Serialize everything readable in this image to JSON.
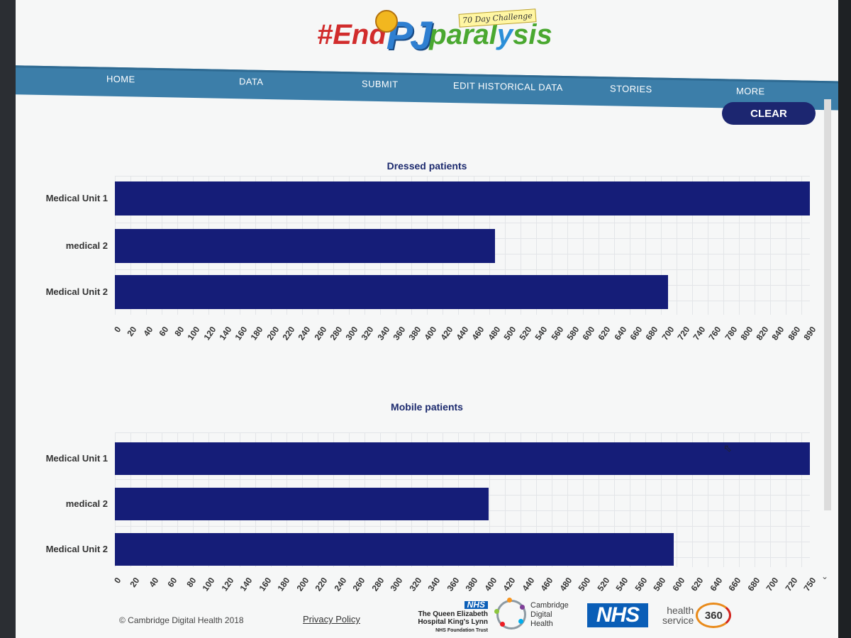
{
  "header": {
    "logo_hash": "#End",
    "logo_pj": "PJ",
    "logo_para": "paral",
    "logo_y": "y",
    "logo_sis": "sis",
    "logo_badge": "70 Day Challenge"
  },
  "nav": {
    "items": [
      {
        "label": "HOME"
      },
      {
        "label": "DATA"
      },
      {
        "label": "SUBMIT"
      },
      {
        "label": "EDIT HISTORICAL DATA"
      },
      {
        "label": "STORIES"
      },
      {
        "label": "MORE"
      }
    ]
  },
  "controls": {
    "clear_label": "CLEAR"
  },
  "chart_data": [
    {
      "type": "bar",
      "orientation": "horizontal",
      "title": "Dressed patients",
      "categories": [
        "Medical Unit 1",
        "medical 2",
        "Medical Unit 2"
      ],
      "values": [
        890,
        487,
        708
      ],
      "xlim": [
        0,
        890
      ],
      "ticks": [
        "0",
        "20",
        "40",
        "60",
        "80",
        "100",
        "120",
        "140",
        "160",
        "180",
        "200",
        "220",
        "240",
        "260",
        "280",
        "300",
        "320",
        "340",
        "360",
        "380",
        "400",
        "420",
        "440",
        "460",
        "480",
        "500",
        "520",
        "540",
        "560",
        "580",
        "600",
        "620",
        "640",
        "660",
        "680",
        "700",
        "720",
        "740",
        "760",
        "780",
        "800",
        "820",
        "840",
        "860",
        "890"
      ],
      "bar_color": "#151d78",
      "grid": true
    },
    {
      "type": "bar",
      "orientation": "horizontal",
      "title": "Mobile patients",
      "categories": [
        "Medical Unit 1",
        "medical 2",
        "Medical Unit 2"
      ],
      "values": [
        750,
        403,
        603
      ],
      "xlim": [
        0,
        750
      ],
      "ticks": [
        "0",
        "20",
        "40",
        "60",
        "80",
        "100",
        "120",
        "140",
        "160",
        "180",
        "200",
        "220",
        "240",
        "260",
        "280",
        "300",
        "320",
        "340",
        "360",
        "380",
        "400",
        "420",
        "440",
        "460",
        "480",
        "500",
        "520",
        "540",
        "560",
        "580",
        "600",
        "620",
        "640",
        "660",
        "680",
        "700",
        "720",
        "750"
      ],
      "bar_color": "#151d78",
      "grid": true
    }
  ],
  "footer": {
    "copyright": "© Cambridge Digital Health 2018",
    "privacy": "Privacy Policy",
    "qe_nhs": "NHS",
    "qe_line1": "The Queen Elizabeth",
    "qe_line2": "Hospital King's Lynn",
    "qe_line3": "NHS Foundation Trust",
    "cdh_line1": "Cambridge",
    "cdh_line2": "Digital",
    "cdh_line3": "Health",
    "nhs_logo": "NHS",
    "h360_line1": "health",
    "h360_line2": "service",
    "h360_num": "360"
  },
  "icons": {
    "cursor": "mouse-pointer-icon",
    "scroll": "chevron-down-icon"
  }
}
